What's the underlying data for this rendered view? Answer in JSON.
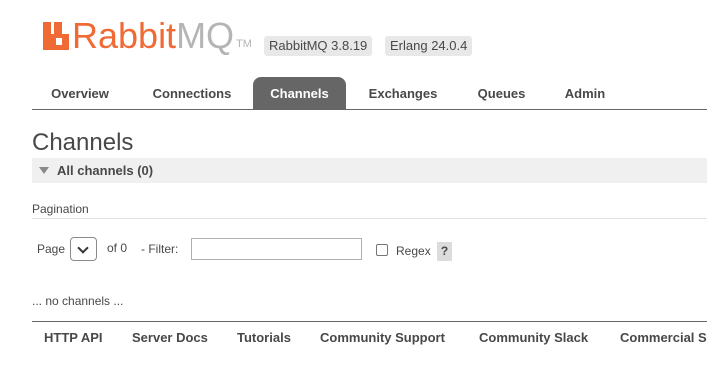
{
  "brand": {
    "logo_primary": "Rabbit",
    "logo_secondary": "MQ",
    "trademark": "TM",
    "accent_color": "#f06a36"
  },
  "versions": {
    "rabbitmq": "RabbitMQ 3.8.19",
    "erlang": "Erlang 24.0.4"
  },
  "tabs": [
    {
      "label": "Overview",
      "active": false
    },
    {
      "label": "Connections",
      "active": false
    },
    {
      "label": "Channels",
      "active": true
    },
    {
      "label": "Exchanges",
      "active": false
    },
    {
      "label": "Queues",
      "active": false
    },
    {
      "label": "Admin",
      "active": false
    }
  ],
  "page": {
    "title": "Channels",
    "section_title": "All channels (0)"
  },
  "pagination": {
    "label": "Pagination",
    "page_label": "Page",
    "page_value": "",
    "of_label": "of 0",
    "filter_label": "- Filter:",
    "filter_value": "",
    "regex_label": "Regex",
    "regex_checked": false,
    "help_label": "?"
  },
  "empty_message": "... no channels ...",
  "footer": {
    "links": [
      "HTTP API",
      "Server Docs",
      "Tutorials",
      "Community Support",
      "Community Slack",
      "Commercial Support"
    ]
  }
}
